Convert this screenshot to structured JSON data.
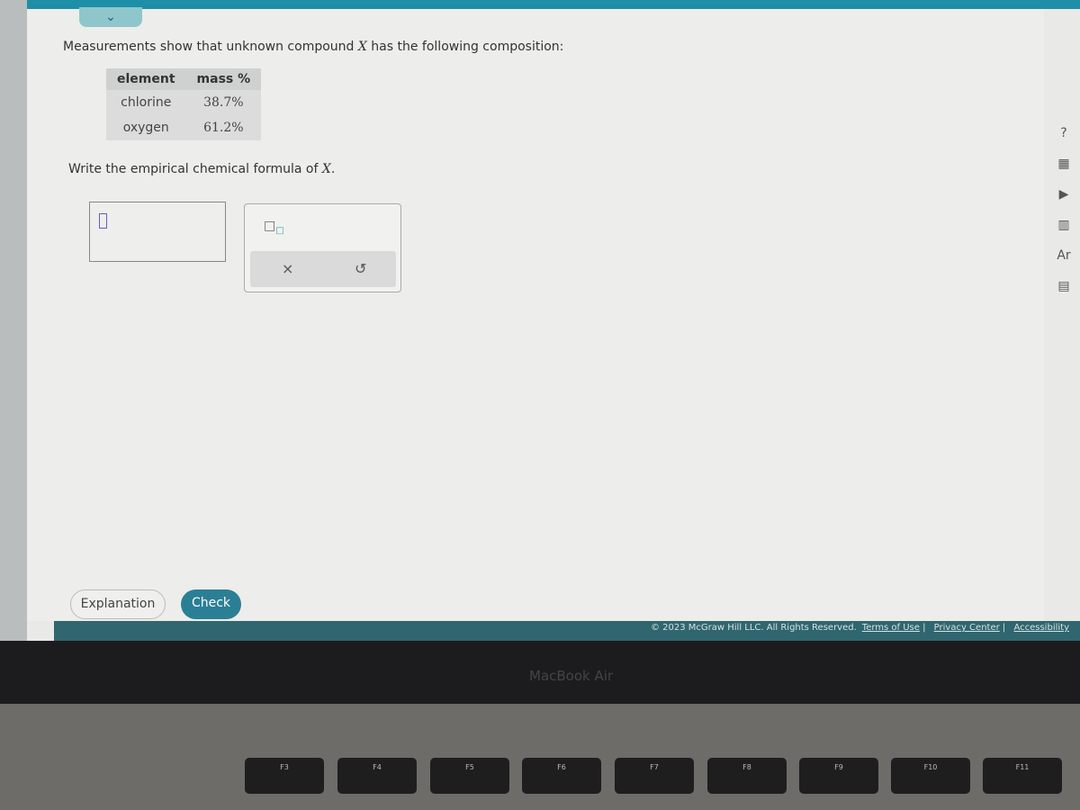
{
  "question": {
    "intro_pre": "Measurements show that unknown compound ",
    "intro_var": "X",
    "intro_post": " has the following composition:",
    "table": {
      "headers": [
        "element",
        "mass %"
      ],
      "rows": [
        [
          "chlorine",
          "38.7%"
        ],
        [
          "oxygen",
          "61.2%"
        ]
      ]
    },
    "prompt_pre": "Write the empirical chemical formula of ",
    "prompt_var": "X",
    "prompt_post": "."
  },
  "palette": {
    "subscript_icon": "subscript-icon",
    "clear": "×",
    "undo": "↺"
  },
  "buttons": {
    "explanation": "Explanation",
    "check": "Check"
  },
  "footer": {
    "copyright": "© 2023 McGraw Hill LLC. All Rights Reserved.",
    "terms": "Terms of Use",
    "privacy": "Privacy Center",
    "accessibility": "Accessibility"
  },
  "tools": {
    "help": "?"
  },
  "laptop": {
    "brand": "MacBook Air",
    "keys": [
      "F3",
      "F4",
      "F5",
      "F6",
      "F7",
      "F8",
      "F9",
      "F10",
      "F11"
    ]
  }
}
